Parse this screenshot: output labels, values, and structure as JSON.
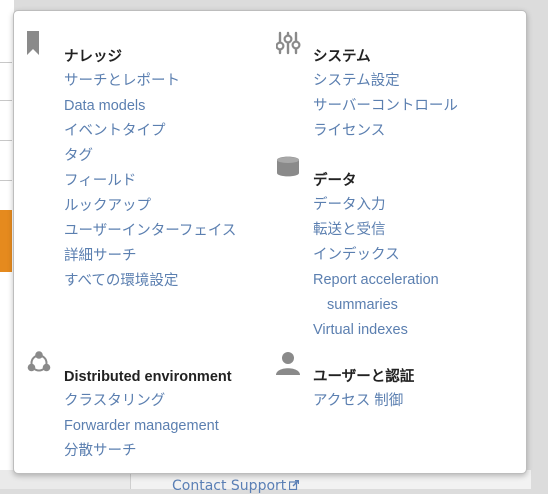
{
  "sections": {
    "knowledge": {
      "icon": "bookmark-icon",
      "title": "ナレッジ",
      "items": [
        "サーチとレポート",
        "Data models",
        "イベントタイプ",
        "タグ",
        "フィールド",
        "ルックアップ",
        "ユーザーインターフェイス",
        "詳細サーチ",
        "すべての環境設定"
      ]
    },
    "system": {
      "icon": "sliders-icon",
      "title": "システム",
      "items": [
        "システム設定",
        "サーバーコントロール",
        "ライセンス"
      ]
    },
    "data": {
      "icon": "database-icon",
      "title": "データ",
      "items": [
        "データ入力",
        "転送と受信",
        "インデックス",
        "Report acceleration",
        "summaries",
        "Virtual indexes"
      ]
    },
    "distributed": {
      "icon": "distributed-network-icon",
      "title": "Distributed environment",
      "items": [
        "クラスタリング",
        "Forwarder management",
        "分散サーチ"
      ]
    },
    "users": {
      "icon": "user-icon",
      "title": "ユーザーと認証",
      "items": [
        "アクセス 制御"
      ]
    }
  },
  "footer": {
    "contact_support": "Contact Support",
    "contact_support_icon": "external-link-icon"
  },
  "colors": {
    "link": "#5b7fb0",
    "title": "#222222",
    "icon": "#8a8a8a",
    "accent_orange": "#e58a1e"
  }
}
